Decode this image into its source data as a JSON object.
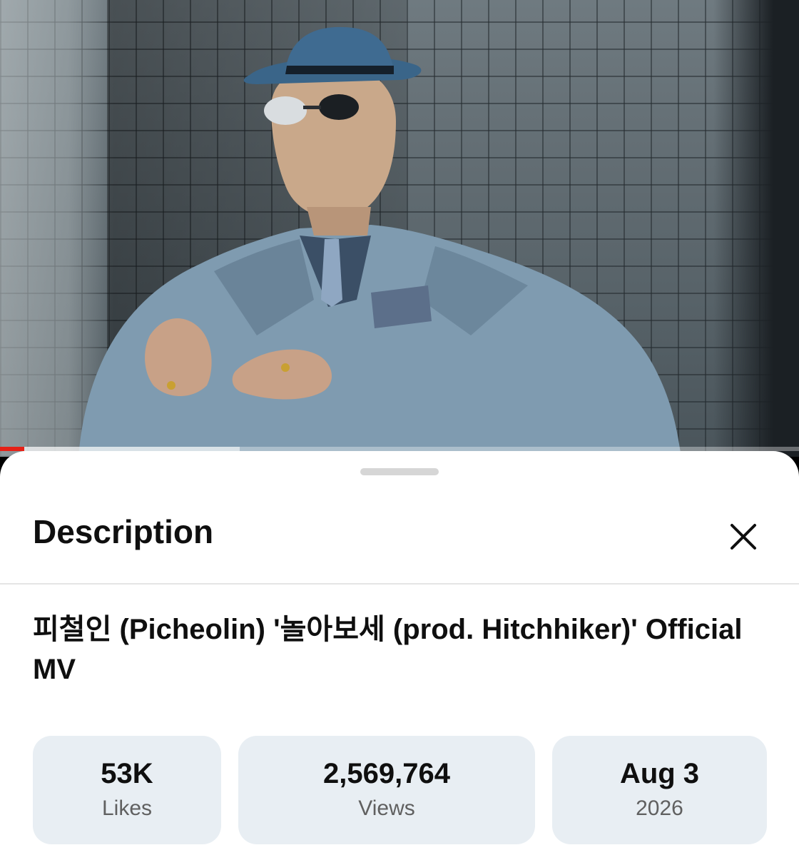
{
  "player": {
    "progress": 0.03,
    "buffered": 0.3,
    "progress_color": "#e62117"
  },
  "sheet": {
    "title": "Description",
    "close_icon": "close-icon"
  },
  "video": {
    "title": "피철인 (Picheolin) '놀아보세 (prod. Hitchhiker)' Official MV"
  },
  "stats": [
    {
      "value": "53K",
      "label": "Likes"
    },
    {
      "value": "2,569,764",
      "label": "Views"
    },
    {
      "value": "Aug 3",
      "label": "2026"
    }
  ]
}
